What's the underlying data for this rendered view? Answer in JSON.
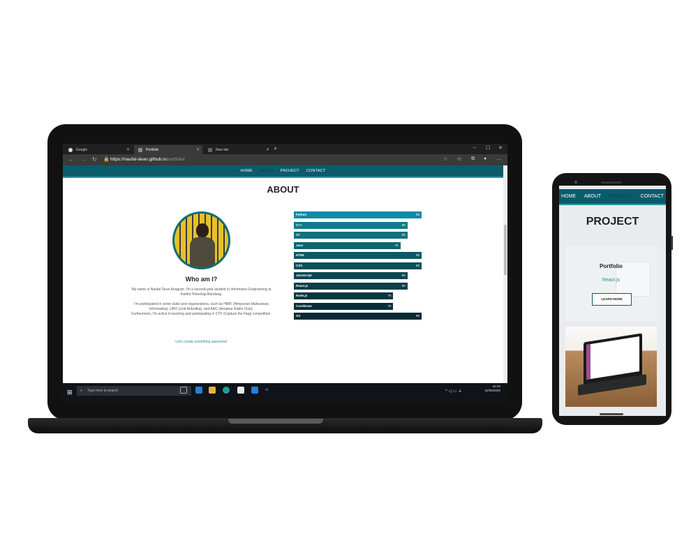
{
  "browser": {
    "tabs": [
      {
        "label": "Google",
        "active": false
      },
      {
        "label": "Portfolio",
        "active": true
      },
      {
        "label": "New tab",
        "active": false
      }
    ],
    "url_domain": "https://naufal-dean.github.io",
    "url_path": "/portfolio/"
  },
  "site": {
    "nav": [
      "HOME",
      "ABOUT",
      "PROJECT",
      "CONTACT"
    ],
    "about_title": "ABOUT",
    "who_title": "Who am I?",
    "bio_1": "My name is Naufal Dean Anugrah. I'm a second-year student in Informatics Engineering at Institut Teknologi Bandung.",
    "bio_2": "I'm participated in some clubs and organizations, such as HMIF (Himpunan Mahasiswa Informatika), URO (Unit Robotika), and ARC (Amateur Radio Club).",
    "bio_3": "Furthermore, I'm active in learning and participating in CTF (Capture the Flag) competition.",
    "cta": "Let's create something awesome!",
    "skills": [
      {
        "name": "Python",
        "value": 90,
        "color": "#0e8aa8"
      },
      {
        "name": "C++",
        "value": 80,
        "color": "#127a8c"
      },
      {
        "name": "C#",
        "value": 80,
        "color": "#10707f"
      },
      {
        "name": "Java",
        "value": 75,
        "color": "#0f6472"
      },
      {
        "name": "HTML",
        "value": 90,
        "color": "#0c5866"
      },
      {
        "name": "CSS",
        "value": 90,
        "color": "#0b4f5c"
      },
      {
        "name": "JavaScript",
        "value": 80,
        "color": "#0a4652"
      },
      {
        "name": "React.js",
        "value": 80,
        "color": "#083e49"
      },
      {
        "name": "Node.js",
        "value": 70,
        "color": "#073640"
      },
      {
        "name": "CorelDraw",
        "value": 70,
        "color": "#062f38"
      },
      {
        "name": "Git",
        "value": 90,
        "color": "#052a33"
      }
    ]
  },
  "taskbar": {
    "search_placeholder": "Type here to search",
    "time": "22:32",
    "date": "22/05/2020"
  },
  "phone": {
    "nav": [
      "HOME",
      "ABOUT",
      "PROJECT",
      "CONTACT"
    ],
    "title": "PROJECT",
    "card_title": "Portfolio",
    "card_sub": "React.js",
    "card_button": "LEARN MORE"
  }
}
